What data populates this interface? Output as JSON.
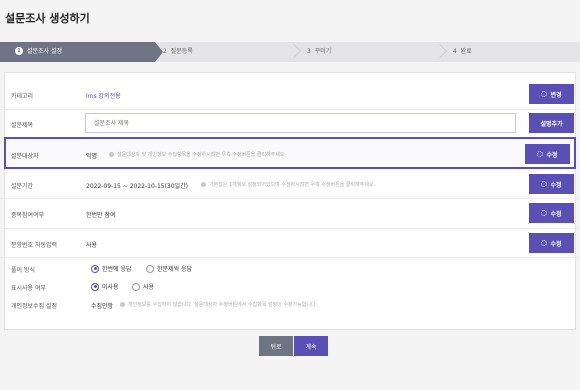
{
  "page": {
    "title": "설문조사 생성하기"
  },
  "steps": [
    {
      "num": "1",
      "label": "설문조사 설정"
    },
    {
      "num": "2",
      "label": "질문등록"
    },
    {
      "num": "3",
      "label": "꾸미기"
    },
    {
      "num": "4",
      "label": "완료"
    }
  ],
  "form": {
    "category": {
      "label": "카테고리",
      "value": "lms 강의전용",
      "button": "변경"
    },
    "title": {
      "label": "설문제목",
      "placeholder": "설문조사 제목",
      "button": "설명추가"
    },
    "target": {
      "label": "설문대상자",
      "value": "익명",
      "hint": "설문대상자 및 개인정보 수집항목을 수정하시려면 우측 수정버튼을 클릭해주세요.",
      "button": "수정"
    },
    "period": {
      "label": "설문기간",
      "value": "2022-09-15 ~ 2022-10-15(30일간)",
      "hint": "기본값은 1개월로 설정되어있으며 수정하시려면 우측 수정버튼을 클릭해주세요.",
      "button": "수정"
    },
    "duplicate": {
      "label": "중복참여여부",
      "value": "한번만 참여",
      "button": "수정"
    },
    "auto_number": {
      "label": "문항번호 자동입력",
      "value": "사용",
      "button": "수정"
    },
    "display_mode": {
      "label": "풀이 방식",
      "options": [
        "한번에 응답",
        "한문제씩 응답"
      ],
      "selected": 0
    },
    "display_use": {
      "label": "표시사용 여부",
      "options": [
        "미사용",
        "사용"
      ],
      "selected": 0
    },
    "privacy": {
      "label": "개인정보수집 설정",
      "value": "수집안함",
      "hint": "개인정보를 수집하지 않습니다. 설문대상자 수정버튼에서 수집항목 설정이 수정가능합니다."
    }
  },
  "footer": {
    "prev": "뒤로",
    "next": "계속"
  },
  "colors": {
    "accent": "#5a4fb5",
    "step_active": "#6e7484"
  }
}
